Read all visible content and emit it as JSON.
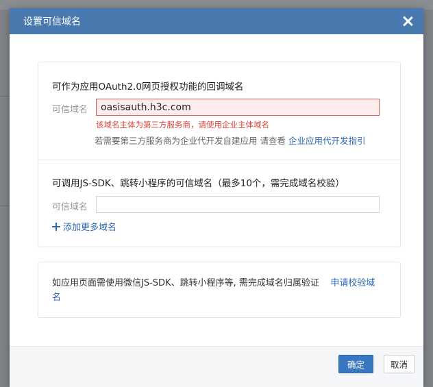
{
  "dialog": {
    "title": "设置可信域名"
  },
  "section1": {
    "title": "可作为应用OAuth2.0网页授权功能的回调域名",
    "field_label": "可信域名",
    "domain_value": "oasisauth.h3c.com",
    "error": "该域名主体为第三方服务商，请使用企业主体域名",
    "hint_text": "若需要第三方服务商为企业代开发自建应用 请查看",
    "hint_link": "企业应用代开发指引"
  },
  "section2": {
    "title": "可调用JS-SDK、跳转小程序的可信域名（最多10个，需完成域名校验）",
    "field_label": "可信域名",
    "domain_value": "",
    "add_more": "添加更多域名"
  },
  "notice": {
    "text": "如应用页面需使用微信JS-SDK、跳转小程序等, 需完成域名归属验证",
    "link": "申请校验域名"
  },
  "footer": {
    "ok": "确定",
    "cancel": "取消"
  },
  "colors": {
    "header": "#4a79af",
    "link": "#2c69b3",
    "error": "#d9443c",
    "primary_button": "#3a77c1"
  }
}
